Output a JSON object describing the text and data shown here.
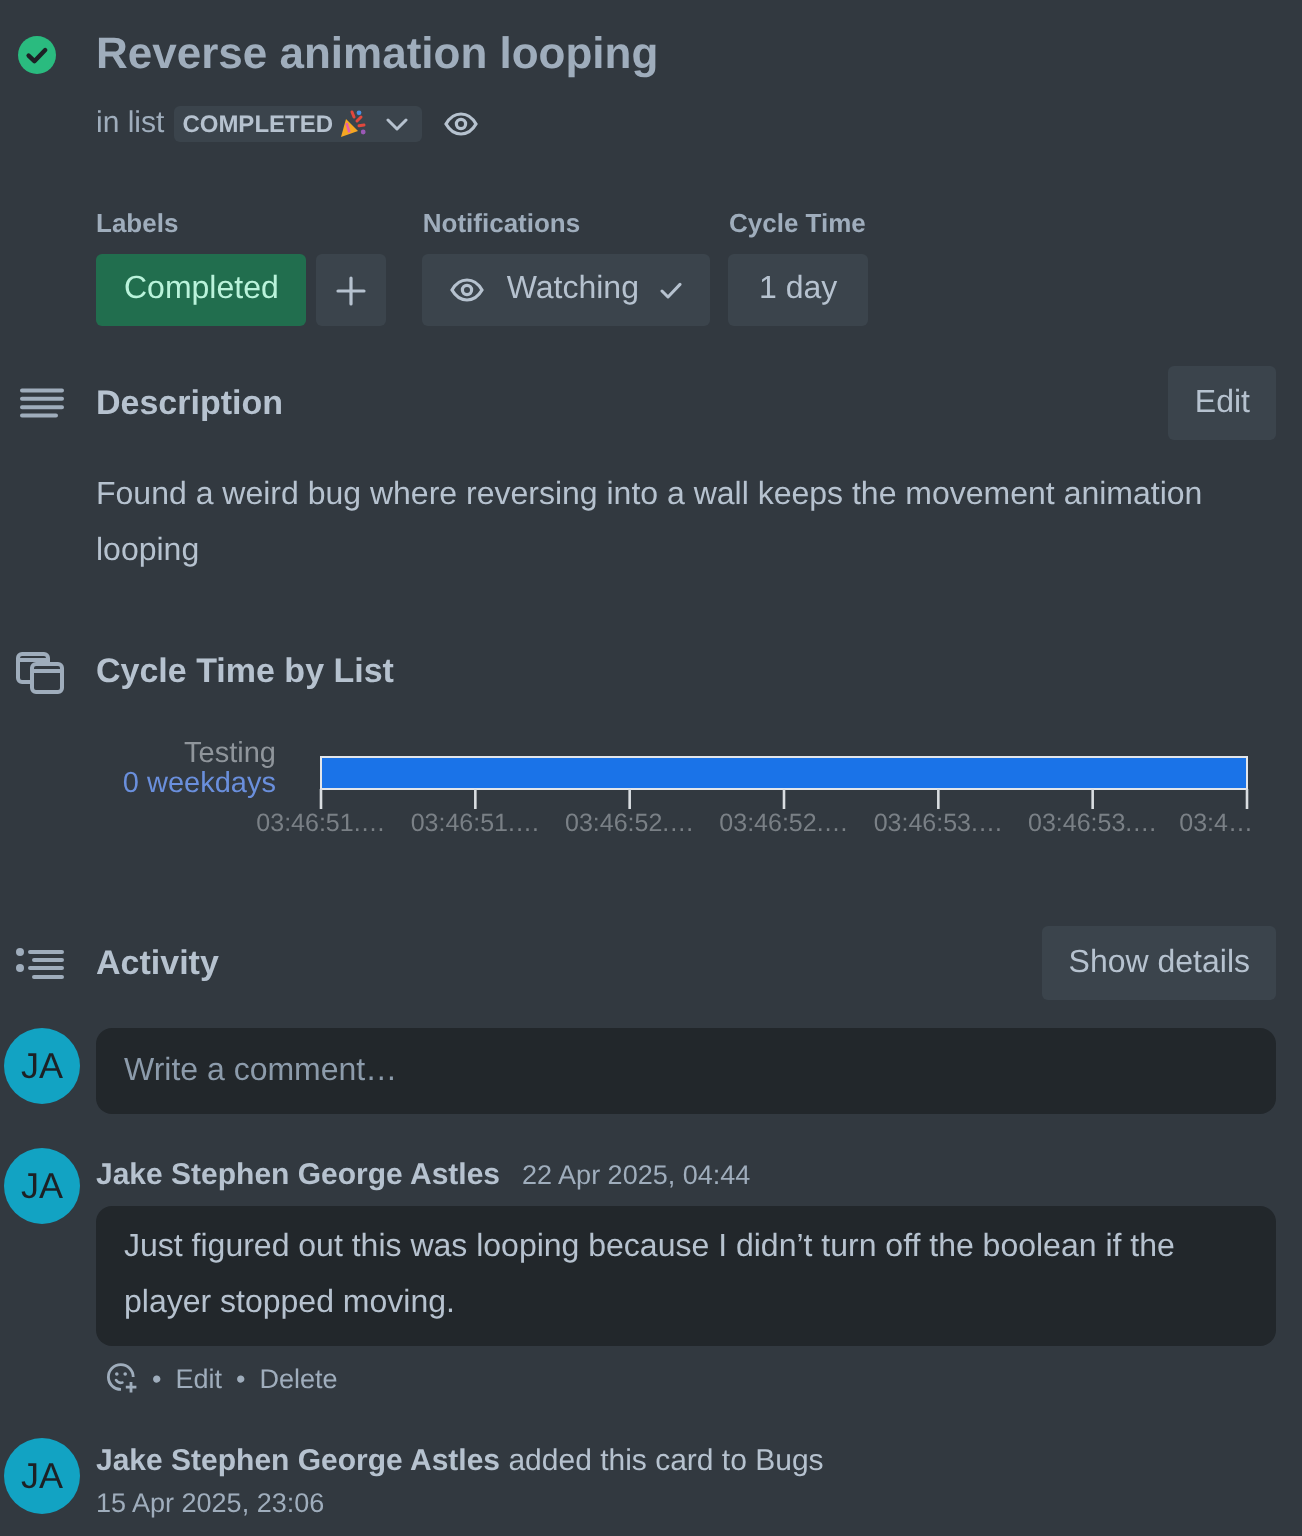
{
  "card": {
    "complete": true,
    "title": "Reverse animation looping",
    "list_prefix": "in list",
    "list_name": "COMPLETED"
  },
  "fields": {
    "labels": {
      "heading": "Labels",
      "items": [
        {
          "text": "Completed",
          "color": "#216e4e"
        }
      ]
    },
    "notifications": {
      "heading": "Notifications",
      "label": "Watching",
      "watching": true
    },
    "cycle_time": {
      "heading": "Cycle Time",
      "value": "1 day"
    }
  },
  "description": {
    "heading": "Description",
    "edit_button": "Edit",
    "text": "Found a weird bug where reversing into a wall keeps the movement animation looping"
  },
  "cycle_time_by_list": {
    "heading": "Cycle Time by List",
    "rows": [
      {
        "list": "Testing",
        "duration": "0 weekdays"
      }
    ],
    "axis_labels": [
      "03:46:51.…",
      "03:46:51.…",
      "03:46:52.…",
      "03:46:52.…",
      "03:46:53.…",
      "03:46:53.…",
      "03:4…"
    ]
  },
  "activity": {
    "heading": "Activity",
    "details_button": "Show details",
    "composer": {
      "avatar": "JA",
      "placeholder": "Write a comment…"
    },
    "entries": [
      {
        "kind": "comment",
        "avatar": "JA",
        "author": "Jake Stephen George Astles",
        "time": "22 Apr 2025, 04:44",
        "text": "Just figured out this was looping because I didn’t turn off the boolean if the player stopped moving.",
        "actions": [
          {
            "separator": "•",
            "label": "Edit"
          },
          {
            "separator": "•",
            "label": "Delete"
          }
        ]
      },
      {
        "kind": "event",
        "avatar": "JA",
        "text": "**Jake Stephen George Astles** added this card to Bugs",
        "time": "15 Apr 2025, 23:06"
      }
    ]
  }
}
